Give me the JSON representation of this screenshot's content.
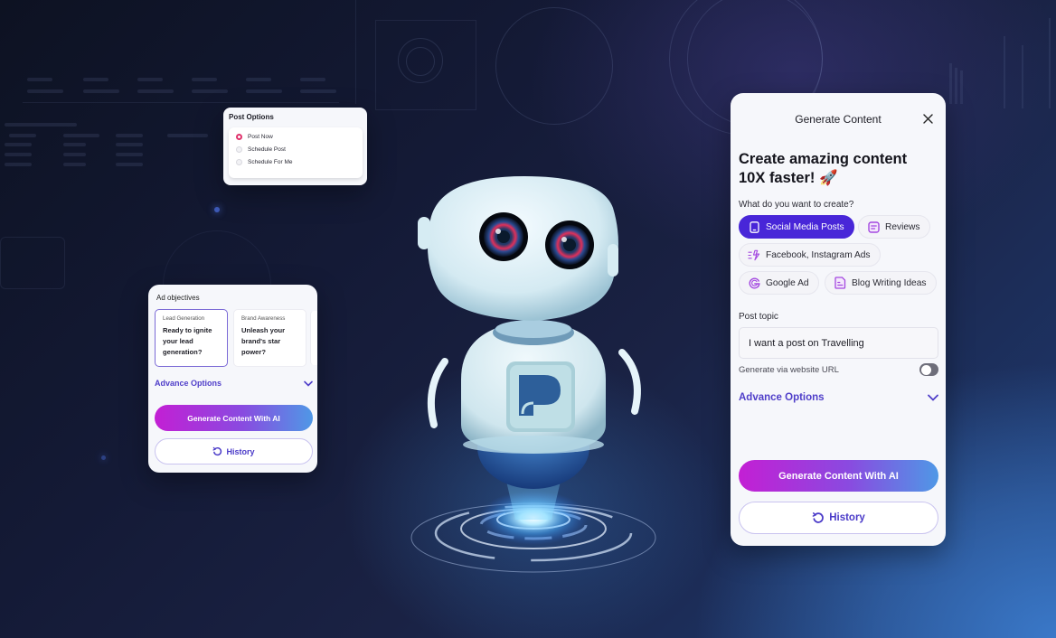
{
  "colors": {
    "accent": "#4826d8",
    "link": "#4f3ec9",
    "radio_checked": "#e0336c",
    "gradient_start": "#c31fd4",
    "gradient_end": "#4f98e6",
    "chip_icon": "#a348e0"
  },
  "post_options": {
    "title": "Post Options",
    "options": [
      {
        "label": "Post Now",
        "checked": true
      },
      {
        "label": "Schedule Post",
        "checked": false
      },
      {
        "label": "Schedule For Me",
        "checked": false
      }
    ]
  },
  "ad_objectives": {
    "title": "Ad objectives",
    "options": [
      {
        "label": "Lead Generation",
        "description": "Ready to ignite your lead generation?",
        "selected": true
      },
      {
        "label": "Brand Awareness",
        "description": "Unleash your brand's star power?",
        "selected": false
      }
    ],
    "advance_options": "Advance Options",
    "generate_button": "Generate Content With AI",
    "history_button": "History"
  },
  "generate_panel": {
    "header": "Generate Content",
    "close_icon": "close-icon",
    "title": "Create amazing content 10X faster! 🚀",
    "question": "What do you want to create?",
    "chips": [
      {
        "label": "Social Media Posts",
        "icon": "phone-icon",
        "active": true
      },
      {
        "label": "Reviews",
        "icon": "review-icon",
        "active": false
      },
      {
        "label": "Facebook, Instagram Ads",
        "icon": "sparkle-icon",
        "active": false
      },
      {
        "label": "Google Ad",
        "icon": "google-icon",
        "active": false
      },
      {
        "label": "Blog Writing Ideas",
        "icon": "blog-icon",
        "active": false
      }
    ],
    "post_topic_label": "Post topic",
    "post_topic_value": "I want a post on Travelling",
    "website_url_label": "Generate via website URL",
    "website_url_toggle": false,
    "advance_options": "Advance Options",
    "generate_button": "Generate Content With AI",
    "history_button": "History"
  }
}
